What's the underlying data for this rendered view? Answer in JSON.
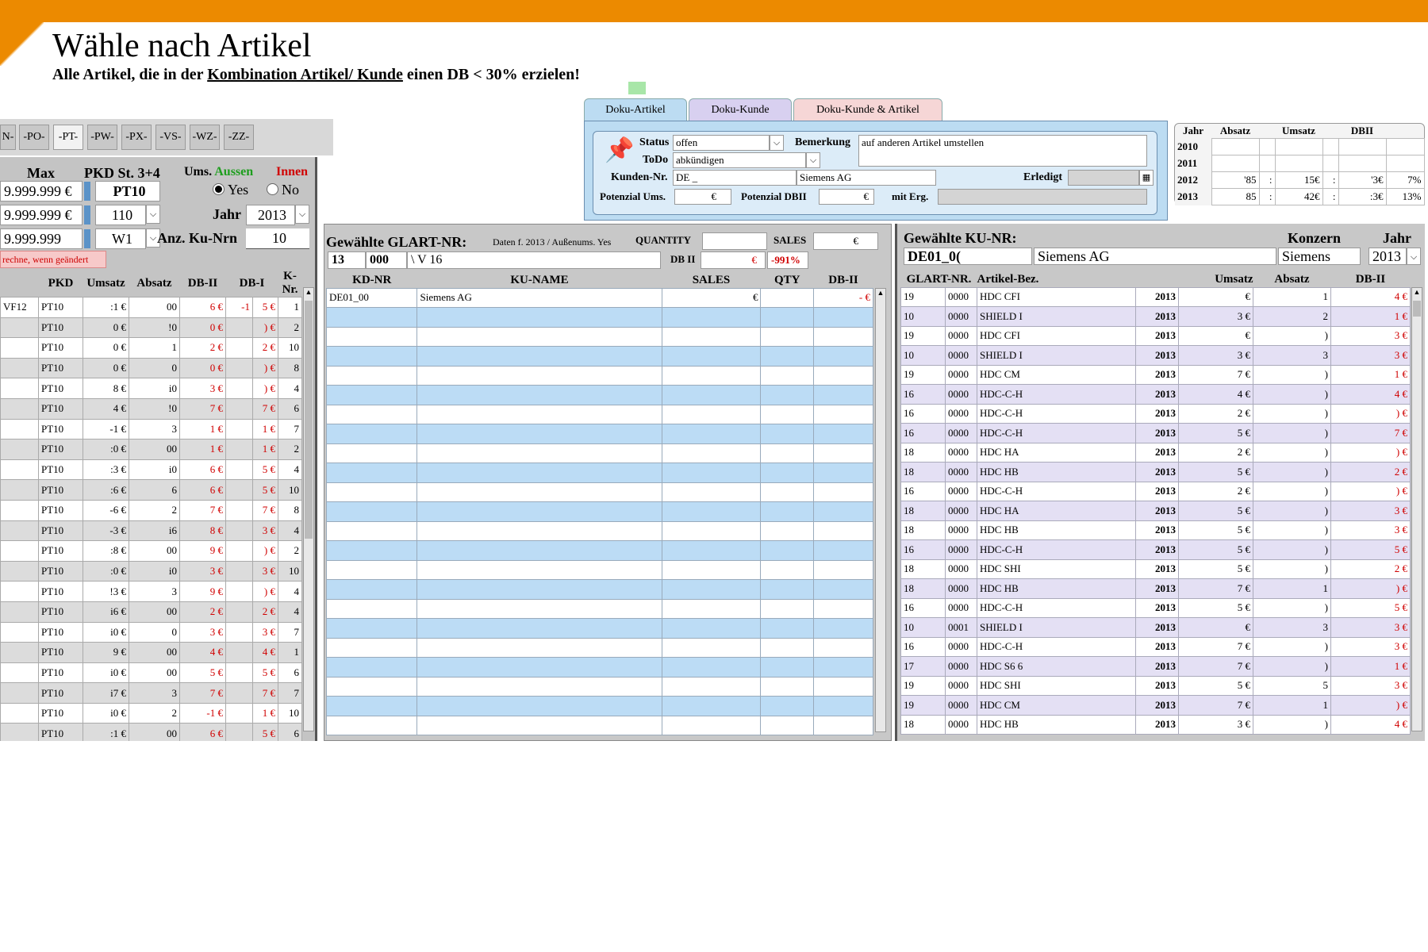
{
  "header": {
    "title": "Wähle nach Artikel",
    "subtitle_pre": "Alle Artikel, die in der",
    "subtitle_link": "Kombination Artikel/ Kunde",
    "subtitle_post": "einen DB < 30% erzielen!"
  },
  "letter_tabs": [
    "N-",
    "-PO-",
    "-PT-",
    "-PW-",
    "-PX-",
    "-VS-",
    "-WZ-",
    "-ZZ-"
  ],
  "left": {
    "max_label": "Max",
    "pkd_label": "PKD St. 3+4",
    "ums_label": "Ums.",
    "aussen_label": "Aussen",
    "innen_label": "Innen",
    "max_values": [
      "9.999.999 €",
      "9.999.999 €",
      "9.999.999"
    ],
    "pkd_value": "PT10",
    "st_value": "110",
    "w_value": "W1",
    "yes_label": "Yes",
    "no_label": "No",
    "jahr_label": "Jahr",
    "jahr_value": "2013",
    "anz_label": "Anz. Ku-Nrn",
    "anz_value": "10",
    "recalc_label": "rechne, wenn geändert",
    "columns": [
      "PKD",
      "Umsatz",
      "Absatz",
      "DB-II",
      "DB-I",
      "K-Nr."
    ],
    "rows": [
      [
        "VF12",
        "PT10",
        ":1 €",
        "00",
        "6 €",
        "-1",
        "5 €",
        "1"
      ],
      [
        "",
        "PT10",
        "0 €",
        "!0",
        "0 €",
        "",
        ") €",
        "2"
      ],
      [
        "",
        "PT10",
        "0 €",
        "1",
        "2 €",
        "",
        "2 €",
        "10"
      ],
      [
        "",
        "PT10",
        "0 €",
        "0",
        "0 €",
        "",
        ") €",
        "8"
      ],
      [
        "",
        "PT10",
        "8 €",
        "i0",
        "3 €",
        "",
        ") €",
        "4"
      ],
      [
        "",
        "PT10",
        "4 €",
        "!0",
        "7 €",
        "",
        "7 €",
        "6"
      ],
      [
        "",
        "PT10",
        "-1 €",
        "3",
        "1 €",
        "",
        "1 €",
        "7"
      ],
      [
        "",
        "PT10",
        ":0 €",
        "00",
        "1 €",
        "",
        "1 €",
        "2"
      ],
      [
        "",
        "PT10",
        ":3 €",
        "i0",
        "6 €",
        "",
        "5 €",
        "4"
      ],
      [
        "",
        "PT10",
        ":6 €",
        "6",
        "6 €",
        "",
        "5 €",
        "10"
      ],
      [
        "",
        "PT10",
        "-6 €",
        "2",
        "7 €",
        "",
        "7 €",
        "8"
      ],
      [
        "",
        "PT10",
        "-3 €",
        "i6",
        "8 €",
        "",
        "3 €",
        "4"
      ],
      [
        "",
        "PT10",
        ":8 €",
        "00",
        "9 €",
        "",
        ") €",
        "2"
      ],
      [
        "",
        "PT10",
        ":0 €",
        "i0",
        "3 €",
        "",
        "3 €",
        "10"
      ],
      [
        "",
        "PT10",
        "!3 €",
        "3",
        "9 €",
        "",
        ") €",
        "4"
      ],
      [
        "",
        "PT10",
        "i6 €",
        "00",
        "2 €",
        "",
        "2 €",
        "4"
      ],
      [
        "",
        "PT10",
        "i0 €",
        "0",
        "3 €",
        "",
        "3 €",
        "7"
      ],
      [
        "",
        "PT10",
        "9 €",
        "00",
        "4 €",
        "",
        "4 €",
        "1"
      ],
      [
        "",
        "PT10",
        "i0 €",
        "00",
        "5 €",
        "",
        "5 €",
        "6"
      ],
      [
        "",
        "PT10",
        "i7 €",
        "3",
        "7 €",
        "",
        "7 €",
        "7"
      ],
      [
        "",
        "PT10",
        "i0 €",
        "2",
        "-1 €",
        "",
        "1 €",
        "10"
      ],
      [
        "",
        "PT10",
        ":1 €",
        "00",
        "6 €",
        "",
        "5 €",
        "6"
      ]
    ]
  },
  "doku": {
    "tabs": [
      "Doku-Artikel",
      "Doku-Kunde",
      "Doku-Kunde & Artikel"
    ],
    "status_label": "Status",
    "status_value": "offen",
    "bemerkung_label": "Bemerkung",
    "bemerkung_value": "auf anderen Artikel umstellen",
    "todo_label": "ToDo",
    "todo_value": "abkündigen",
    "kunden_label": "Kunden-Nr.",
    "kunden_value": "DE _",
    "kunden_name": "Siemens AG",
    "erledigt_label": "Erledigt",
    "potenzial_ums_label": "Potenzial Ums.",
    "potenzial_ums_value": "€",
    "potenzial_db_label": "Potenzial DBII",
    "potenzial_db_value": "€",
    "mit_erg_label": "mit Erg."
  },
  "jahr_table": {
    "columns": [
      "Jahr",
      "Absatz",
      "Umsatz",
      "DBII"
    ],
    "rows": [
      [
        "2010",
        "",
        "",
        "",
        "",
        "",
        ""
      ],
      [
        "2011",
        "",
        "",
        "",
        "",
        "",
        ""
      ],
      [
        "2012",
        "'85",
        ":",
        "15€",
        ":",
        "'3€",
        "7%"
      ],
      [
        "2013",
        "85",
        ":",
        "42€",
        ":",
        ":3€",
        "13%"
      ]
    ]
  },
  "middle": {
    "title": "Gewählte GLART-NR:",
    "daten_note": "Daten f. 2013 / Außenums. Yes",
    "quantity_label": "QUANTITY",
    "sales_label": "SALES",
    "sales_value": "€",
    "glart_a": "13",
    "glart_b": "000",
    "glart_c": "\\ V 16",
    "db_label": "DB II",
    "db_value": "€",
    "db_pct": "-991%",
    "columns": [
      "KD-NR",
      "KU-NAME",
      "SALES",
      "QTY",
      "DB-II"
    ],
    "rows": [
      [
        "DE01_00",
        "Siemens AG",
        "€",
        "",
        "- €"
      ]
    ],
    "empty_rows": 22
  },
  "right": {
    "title": "Gewählte KU-NR:",
    "konzern_label": "Konzern",
    "jahr_label": "Jahr",
    "ku_nr": "DE01_0(",
    "ku_name": "Siemens AG",
    "konzern_value": "Siemens",
    "jahr_value": "2013",
    "columns": [
      "GLART-NR.",
      "Artikel-Bez.",
      "Umsatz",
      "Absatz",
      "DB-II"
    ],
    "rows": [
      [
        "19",
        "0000",
        "HDC CFI",
        "2013",
        "€",
        "1",
        "4 €"
      ],
      [
        "10",
        "0000",
        "SHIELD I",
        "2013",
        "3 €",
        "2",
        "1 €"
      ],
      [
        "19",
        "0000",
        "HDC CFI",
        "2013",
        "€",
        ")",
        "3 €"
      ],
      [
        "10",
        "0000",
        "SHIELD I",
        "2013",
        "3 €",
        "3",
        "3 €"
      ],
      [
        "19",
        "0000",
        "HDC CM",
        "2013",
        "7 €",
        ")",
        "1 €"
      ],
      [
        "16",
        "0000",
        "HDC-C-H",
        "2013",
        "4 €",
        ")",
        "4 €"
      ],
      [
        "16",
        "0000",
        "HDC-C-H",
        "2013",
        "2 €",
        ")",
        ") €"
      ],
      [
        "16",
        "0000",
        "HDC-C-H",
        "2013",
        "5 €",
        ")",
        "7 €"
      ],
      [
        "18",
        "0000",
        "HDC HA",
        "2013",
        "2 €",
        ")",
        ") €"
      ],
      [
        "18",
        "0000",
        "HDC HB",
        "2013",
        "5 €",
        ")",
        "2 €"
      ],
      [
        "16",
        "0000",
        "HDC-C-H",
        "2013",
        "2 €",
        ")",
        ") €"
      ],
      [
        "18",
        "0000",
        "HDC HA",
        "2013",
        "5 €",
        ")",
        "3 €"
      ],
      [
        "18",
        "0000",
        "HDC HB",
        "2013",
        "5 €",
        ")",
        "3 €"
      ],
      [
        "16",
        "0000",
        "HDC-C-H",
        "2013",
        "5 €",
        ")",
        "5 €"
      ],
      [
        "18",
        "0000",
        "HDC SHI",
        "2013",
        "5 €",
        ")",
        "2 €"
      ],
      [
        "18",
        "0000",
        "HDC HB",
        "2013",
        "7 €",
        "1",
        ") €"
      ],
      [
        "16",
        "0000",
        "HDC-C-H",
        "2013",
        "5 €",
        ")",
        "5 €"
      ],
      [
        "10",
        "0001",
        "SHIELD I",
        "2013",
        "€",
        "3",
        "3 €"
      ],
      [
        "16",
        "0000",
        "HDC-C-H",
        "2013",
        "7 €",
        ")",
        "3 €"
      ],
      [
        "17",
        "0000",
        "HDC S6 6",
        "2013",
        "7 €",
        ")",
        "1 €"
      ],
      [
        "19",
        "0000",
        "HDC SHI",
        "2013",
        "5 €",
        "5",
        "3 €"
      ],
      [
        "19",
        "0000",
        "HDC CM",
        "2013",
        "7 €",
        "1",
        ") €"
      ],
      [
        "18",
        "0000",
        "HDC HB",
        "2013",
        "3 €",
        ")",
        "4 €"
      ]
    ]
  },
  "colors": {
    "topbar": "#ec8a00",
    "aussen": "#1e9e1e",
    "innen": "#d00000",
    "negative": "#d00000"
  }
}
